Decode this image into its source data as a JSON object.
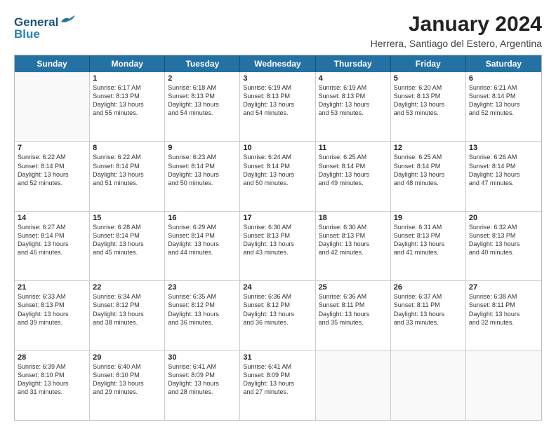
{
  "header": {
    "logo_line1": "General",
    "logo_line2": "Blue",
    "main_title": "January 2024",
    "subtitle": "Herrera, Santiago del Estero, Argentina"
  },
  "days_of_week": [
    "Sunday",
    "Monday",
    "Tuesday",
    "Wednesday",
    "Thursday",
    "Friday",
    "Saturday"
  ],
  "weeks": [
    [
      {
        "day": "",
        "empty": true
      },
      {
        "day": "1",
        "lines": [
          "Sunrise: 6:17 AM",
          "Sunset: 8:13 PM",
          "Daylight: 13 hours",
          "and 55 minutes."
        ]
      },
      {
        "day": "2",
        "lines": [
          "Sunrise: 6:18 AM",
          "Sunset: 8:13 PM",
          "Daylight: 13 hours",
          "and 54 minutes."
        ]
      },
      {
        "day": "3",
        "lines": [
          "Sunrise: 6:19 AM",
          "Sunset: 8:13 PM",
          "Daylight: 13 hours",
          "and 54 minutes."
        ]
      },
      {
        "day": "4",
        "lines": [
          "Sunrise: 6:19 AM",
          "Sunset: 8:13 PM",
          "Daylight: 13 hours",
          "and 53 minutes."
        ]
      },
      {
        "day": "5",
        "lines": [
          "Sunrise: 6:20 AM",
          "Sunset: 8:13 PM",
          "Daylight: 13 hours",
          "and 53 minutes."
        ]
      },
      {
        "day": "6",
        "lines": [
          "Sunrise: 6:21 AM",
          "Sunset: 8:14 PM",
          "Daylight: 13 hours",
          "and 52 minutes."
        ]
      }
    ],
    [
      {
        "day": "7",
        "lines": [
          "Sunrise: 6:22 AM",
          "Sunset: 8:14 PM",
          "Daylight: 13 hours",
          "and 52 minutes."
        ]
      },
      {
        "day": "8",
        "lines": [
          "Sunrise: 6:22 AM",
          "Sunset: 8:14 PM",
          "Daylight: 13 hours",
          "and 51 minutes."
        ]
      },
      {
        "day": "9",
        "lines": [
          "Sunrise: 6:23 AM",
          "Sunset: 8:14 PM",
          "Daylight: 13 hours",
          "and 50 minutes."
        ]
      },
      {
        "day": "10",
        "lines": [
          "Sunrise: 6:24 AM",
          "Sunset: 8:14 PM",
          "Daylight: 13 hours",
          "and 50 minutes."
        ]
      },
      {
        "day": "11",
        "lines": [
          "Sunrise: 6:25 AM",
          "Sunset: 8:14 PM",
          "Daylight: 13 hours",
          "and 49 minutes."
        ]
      },
      {
        "day": "12",
        "lines": [
          "Sunrise: 6:25 AM",
          "Sunset: 8:14 PM",
          "Daylight: 13 hours",
          "and 48 minutes."
        ]
      },
      {
        "day": "13",
        "lines": [
          "Sunrise: 6:26 AM",
          "Sunset: 8:14 PM",
          "Daylight: 13 hours",
          "and 47 minutes."
        ]
      }
    ],
    [
      {
        "day": "14",
        "lines": [
          "Sunrise: 6:27 AM",
          "Sunset: 8:14 PM",
          "Daylight: 13 hours",
          "and 46 minutes."
        ]
      },
      {
        "day": "15",
        "lines": [
          "Sunrise: 6:28 AM",
          "Sunset: 8:14 PM",
          "Daylight: 13 hours",
          "and 45 minutes."
        ]
      },
      {
        "day": "16",
        "lines": [
          "Sunrise: 6:29 AM",
          "Sunset: 8:14 PM",
          "Daylight: 13 hours",
          "and 44 minutes."
        ]
      },
      {
        "day": "17",
        "lines": [
          "Sunrise: 6:30 AM",
          "Sunset: 8:13 PM",
          "Daylight: 13 hours",
          "and 43 minutes."
        ]
      },
      {
        "day": "18",
        "lines": [
          "Sunrise: 6:30 AM",
          "Sunset: 8:13 PM",
          "Daylight: 13 hours",
          "and 42 minutes."
        ]
      },
      {
        "day": "19",
        "lines": [
          "Sunrise: 6:31 AM",
          "Sunset: 8:13 PM",
          "Daylight: 13 hours",
          "and 41 minutes."
        ]
      },
      {
        "day": "20",
        "lines": [
          "Sunrise: 6:32 AM",
          "Sunset: 8:13 PM",
          "Daylight: 13 hours",
          "and 40 minutes."
        ]
      }
    ],
    [
      {
        "day": "21",
        "lines": [
          "Sunrise: 6:33 AM",
          "Sunset: 8:13 PM",
          "Daylight: 13 hours",
          "and 39 minutes."
        ]
      },
      {
        "day": "22",
        "lines": [
          "Sunrise: 6:34 AM",
          "Sunset: 8:12 PM",
          "Daylight: 13 hours",
          "and 38 minutes."
        ]
      },
      {
        "day": "23",
        "lines": [
          "Sunrise: 6:35 AM",
          "Sunset: 8:12 PM",
          "Daylight: 13 hours",
          "and 36 minutes."
        ]
      },
      {
        "day": "24",
        "lines": [
          "Sunrise: 6:36 AM",
          "Sunset: 8:12 PM",
          "Daylight: 13 hours",
          "and 36 minutes."
        ]
      },
      {
        "day": "25",
        "lines": [
          "Sunrise: 6:36 AM",
          "Sunset: 8:11 PM",
          "Daylight: 13 hours",
          "and 35 minutes."
        ]
      },
      {
        "day": "26",
        "lines": [
          "Sunrise: 6:37 AM",
          "Sunset: 8:11 PM",
          "Daylight: 13 hours",
          "and 33 minutes."
        ]
      },
      {
        "day": "27",
        "lines": [
          "Sunrise: 6:38 AM",
          "Sunset: 8:11 PM",
          "Daylight: 13 hours",
          "and 32 minutes."
        ]
      }
    ],
    [
      {
        "day": "28",
        "lines": [
          "Sunrise: 6:39 AM",
          "Sunset: 8:10 PM",
          "Daylight: 13 hours",
          "and 31 minutes."
        ]
      },
      {
        "day": "29",
        "lines": [
          "Sunrise: 6:40 AM",
          "Sunset: 8:10 PM",
          "Daylight: 13 hours",
          "and 29 minutes."
        ]
      },
      {
        "day": "30",
        "lines": [
          "Sunrise: 6:41 AM",
          "Sunset: 8:09 PM",
          "Daylight: 13 hours",
          "and 28 minutes."
        ]
      },
      {
        "day": "31",
        "lines": [
          "Sunrise: 6:41 AM",
          "Sunset: 8:09 PM",
          "Daylight: 13 hours",
          "and 27 minutes."
        ]
      },
      {
        "day": "",
        "empty": true
      },
      {
        "day": "",
        "empty": true
      },
      {
        "day": "",
        "empty": true
      }
    ]
  ]
}
